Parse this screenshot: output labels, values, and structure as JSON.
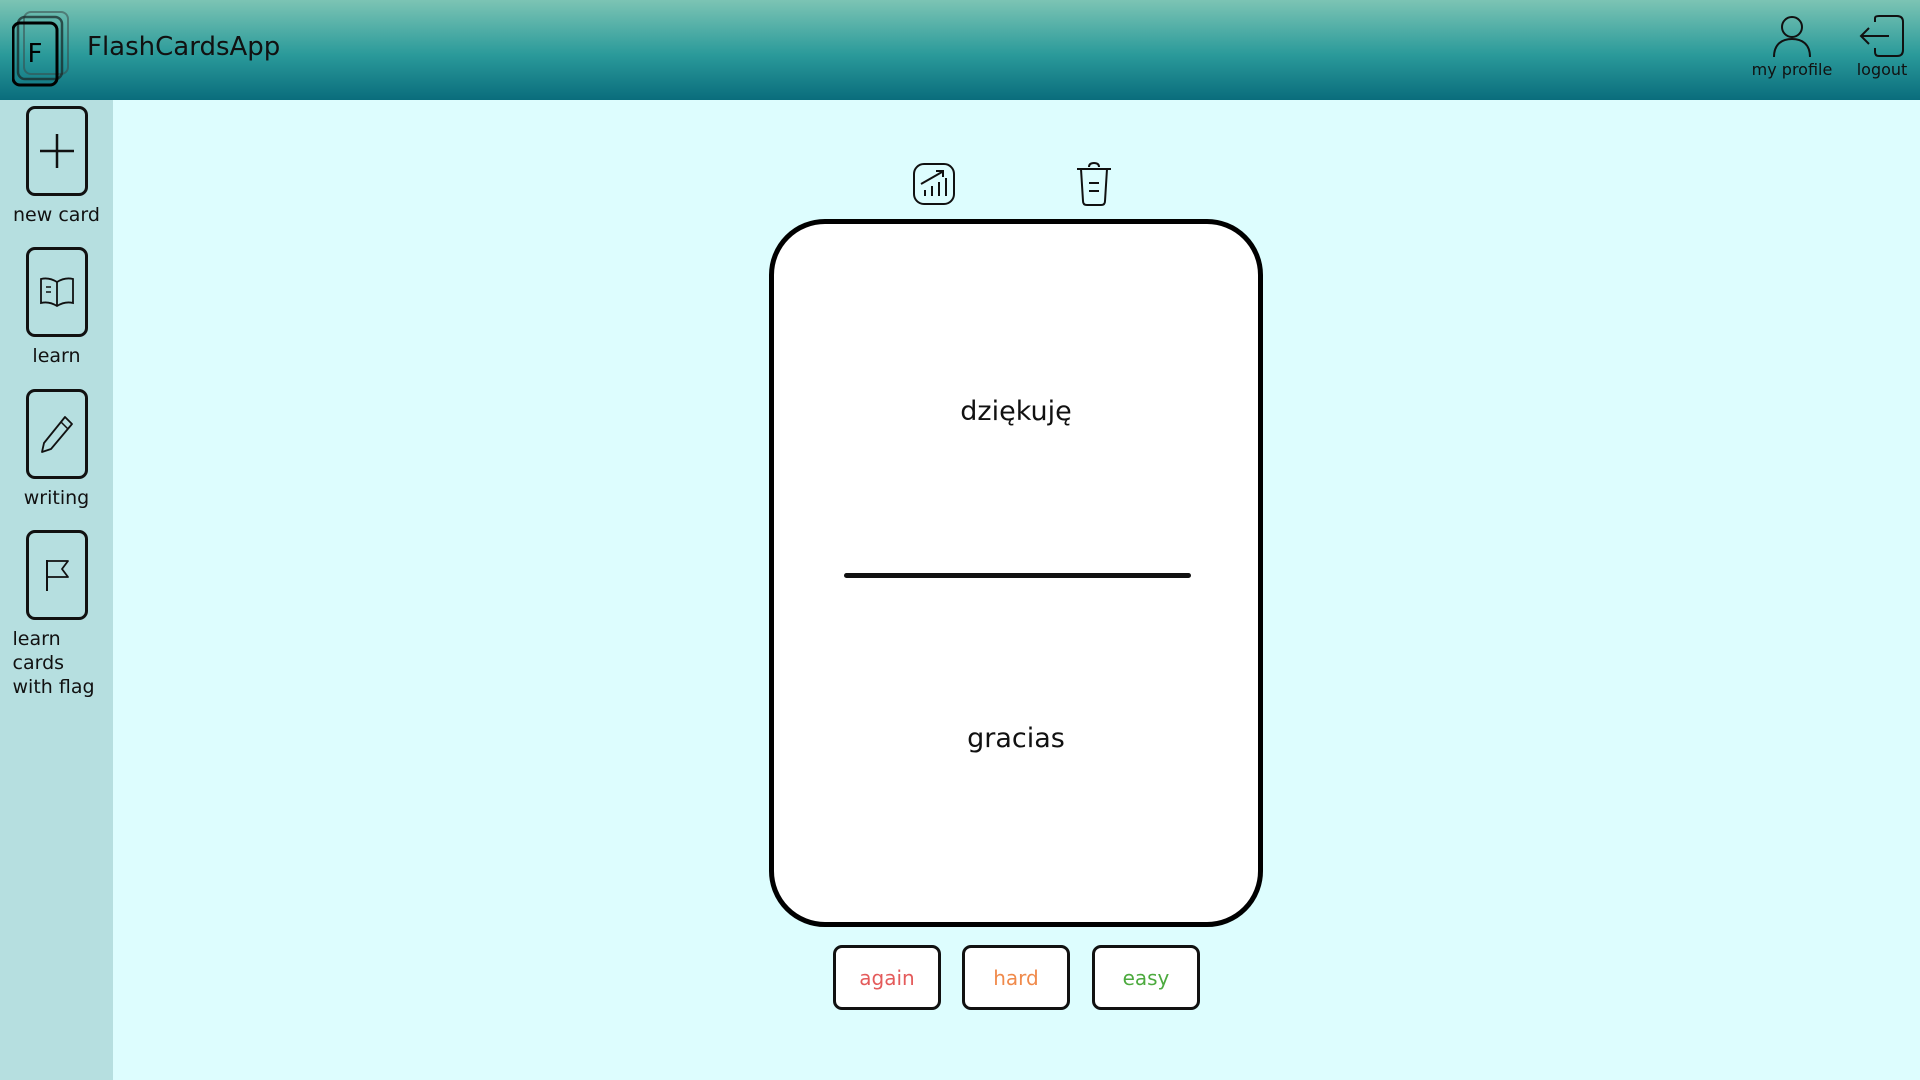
{
  "app": {
    "title": "FlashCardsApp",
    "logo_letter": "F"
  },
  "header": {
    "profile_label": "my profile",
    "logout_label": "logout"
  },
  "sidebar": {
    "items": [
      {
        "label": "new card",
        "icon": "plus-icon"
      },
      {
        "label": "learn",
        "icon": "book-icon"
      },
      {
        "label": "writing",
        "icon": "pencil-icon"
      },
      {
        "label_line1": "learn cards",
        "label_line2": "with flag",
        "icon": "flag-icon"
      }
    ]
  },
  "card": {
    "front": "dziękuję",
    "back": "gracias"
  },
  "toolbar": {
    "stats_icon": "stats-icon",
    "delete_icon": "trash-icon"
  },
  "ratings": [
    {
      "label": "again",
      "color": "#e45b5b"
    },
    {
      "label": "hard",
      "color": "#f08a4b"
    },
    {
      "label": "easy",
      "color": "#4caa3e"
    }
  ],
  "colors": {
    "background": "#ddfdfe",
    "sidebar": "#b6dfe0",
    "header_top": "#7cc4b4",
    "header_bottom": "#0a6d7c"
  }
}
